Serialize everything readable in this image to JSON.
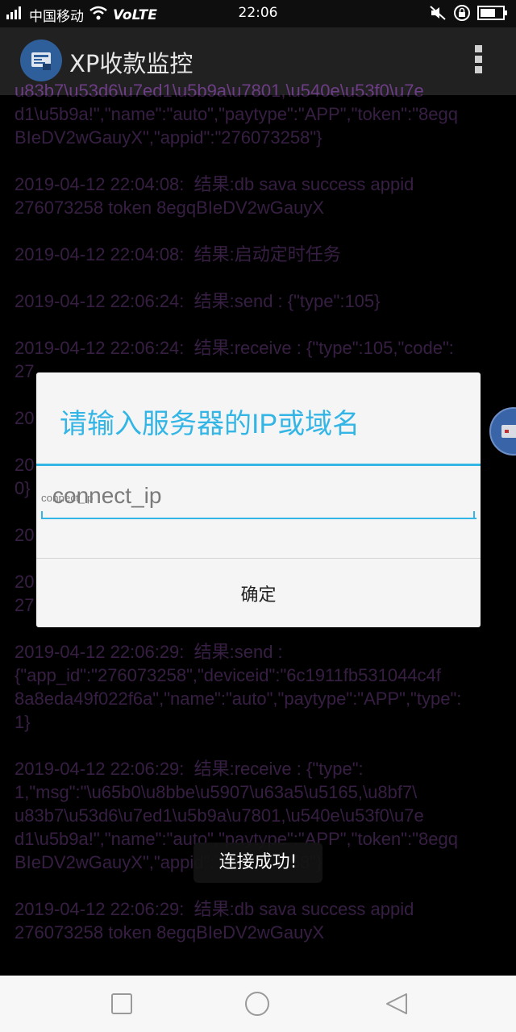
{
  "status_bar": {
    "carrier": "中国移动",
    "network": "VoLTE",
    "time": "22:06"
  },
  "app_bar": {
    "title": "XP收款监控",
    "icon": "app-logo-icon",
    "menu_icon": "overflow-menu-icon"
  },
  "log_lines": [
    "u83b7\\u53d6\\u7ed1\\u5b9a\\u7801,\\u540e\\u53f0\\u7e\nd1\\u5b9a!\",\"name\":\"auto\",\"paytype\":\"APP\",\"token\":\"8egq\nBIeDV2wGauyX\",\"appid\":\"276073258\"}",
    "2019-04-12 22:04:08:  结果:db sava success appid\n276073258 token 8egqBIeDV2wGauyX",
    "2019-04-12 22:04:08:  结果:启动定时任务",
    "2019-04-12 22:06:24:  结果:send : {\"type\":105}",
    "2019-04-12 22:06:24:  结果:receive : {\"type\":105,\"code\":\n27",
    "20",
    "20                                                                  e\":\n0}",
    "20",
    "20\n27",
    "2019-04-12 22:06:29:  结果:send :\n{\"app_id\":\"276073258\",\"deviceid\":\"6c1911fb531044c4f\n8a8eda49f022f6a\",\"name\":\"auto\",\"paytype\":\"APP\",\"type\":\n1}",
    "2019-04-12 22:06:29:  结果:receive : {\"type\":\n1,\"msg\":\"\\u65b0\\u8bbe\\u5907\\u63a5\\u5165,\\u8bf7\\\nu83b7\\u53d6\\u7ed1\\u5b9a\\u7801,\\u540e\\u53f0\\u7e\nd1\\u5b9a!\",\"name\":\"auto\",\"paytype\":\"APP\",\"token\":\"8egq\nBIeDV2wGauyX\",\"appid\":\"276073258\"}",
    "2019-04-12 22:06:29:  结果:db sava success appid\n276073258 token 8egqBIeDV2wGauyX"
  ],
  "dialog": {
    "title": "请输入服务器的IP或域名",
    "input_placeholder": "connect_ip",
    "ok_label": "确定"
  },
  "toast": "连接成功!",
  "nav_bar": {
    "recent_icon": "square-icon",
    "home_icon": "circle-icon",
    "back_icon": "triangle-back-icon"
  }
}
